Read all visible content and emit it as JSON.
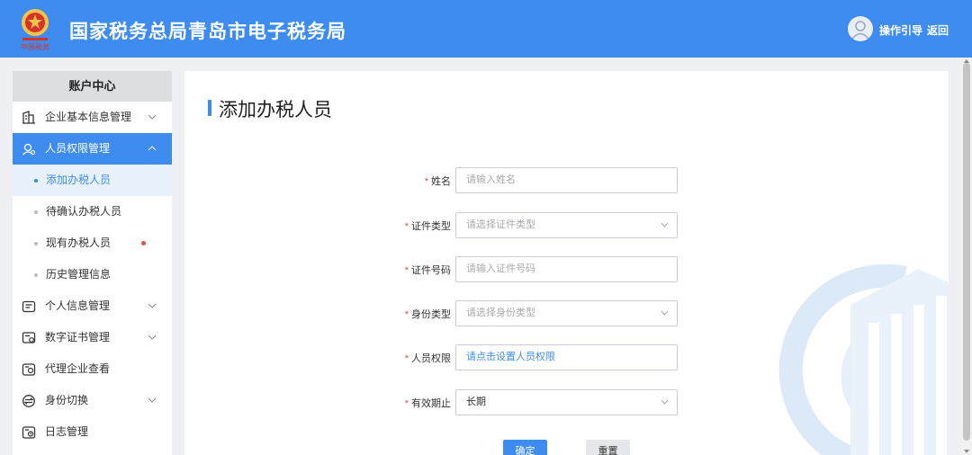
{
  "header": {
    "site_title": "国家税务总局青岛市电子税务局",
    "guide_label": "操作引导",
    "back_label": "返回"
  },
  "sidebar": {
    "title": "账户中心",
    "items": [
      {
        "label": "企业基本信息管理",
        "icon": "building-icon",
        "expandable": true
      },
      {
        "label": "人员权限管理",
        "icon": "user-permission-icon",
        "expandable": true,
        "active": true
      },
      {
        "label": "个人信息管理",
        "icon": "id-card-icon",
        "expandable": true
      },
      {
        "label": "数字证书管理",
        "icon": "certificate-icon",
        "expandable": true
      },
      {
        "label": "代理企业查看",
        "icon": "agency-icon",
        "expandable": false
      },
      {
        "label": "身份切换",
        "icon": "switch-icon",
        "expandable": true
      },
      {
        "label": "日志管理",
        "icon": "log-icon",
        "expandable": false
      }
    ],
    "sub_items": [
      {
        "label": "添加办税人员",
        "current": true
      },
      {
        "label": "待确认办税人员"
      },
      {
        "label": "现有办税人员",
        "badge": true
      },
      {
        "label": "历史管理信息"
      }
    ]
  },
  "main": {
    "page_title": "添加办税人员",
    "form": {
      "name": {
        "label": "姓名",
        "placeholder": "请输入姓名"
      },
      "id_type": {
        "label": "证件类型",
        "placeholder": "请选择证件类型"
      },
      "id_number": {
        "label": "证件号码",
        "placeholder": "请输入证件号码"
      },
      "identity_type": {
        "label": "身份类型",
        "placeholder": "请选择身份类型"
      },
      "permission": {
        "label": "人员权限",
        "placeholder": "请点击设置人员权限"
      },
      "validity": {
        "label": "有效期止",
        "value": "长期"
      }
    },
    "confirm_label": "确定",
    "reset_label": "重置"
  },
  "colors": {
    "brand": "#3f8cf0",
    "required": "#f04848"
  }
}
